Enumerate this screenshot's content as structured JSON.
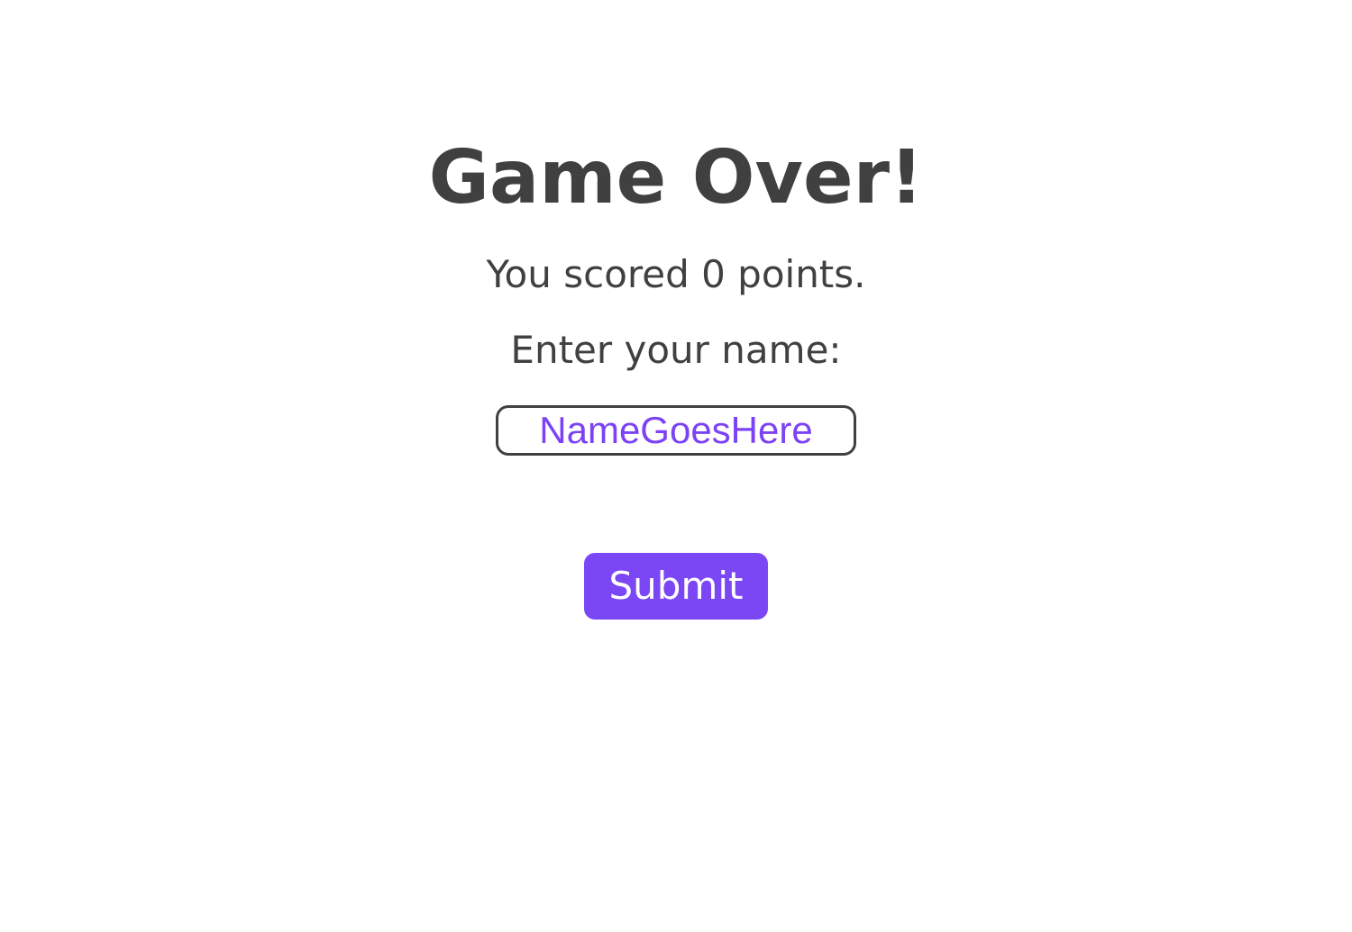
{
  "game_over": {
    "title": "Game Over!",
    "score_text": "You scored 0 points.",
    "name_prompt": "Enter your name:",
    "name_input": {
      "value": "",
      "placeholder": "NameGoesHere"
    },
    "submit_label": "Submit"
  },
  "colors": {
    "accent": "#7b47f4",
    "text": "#404040",
    "background": "#ffffff"
  }
}
